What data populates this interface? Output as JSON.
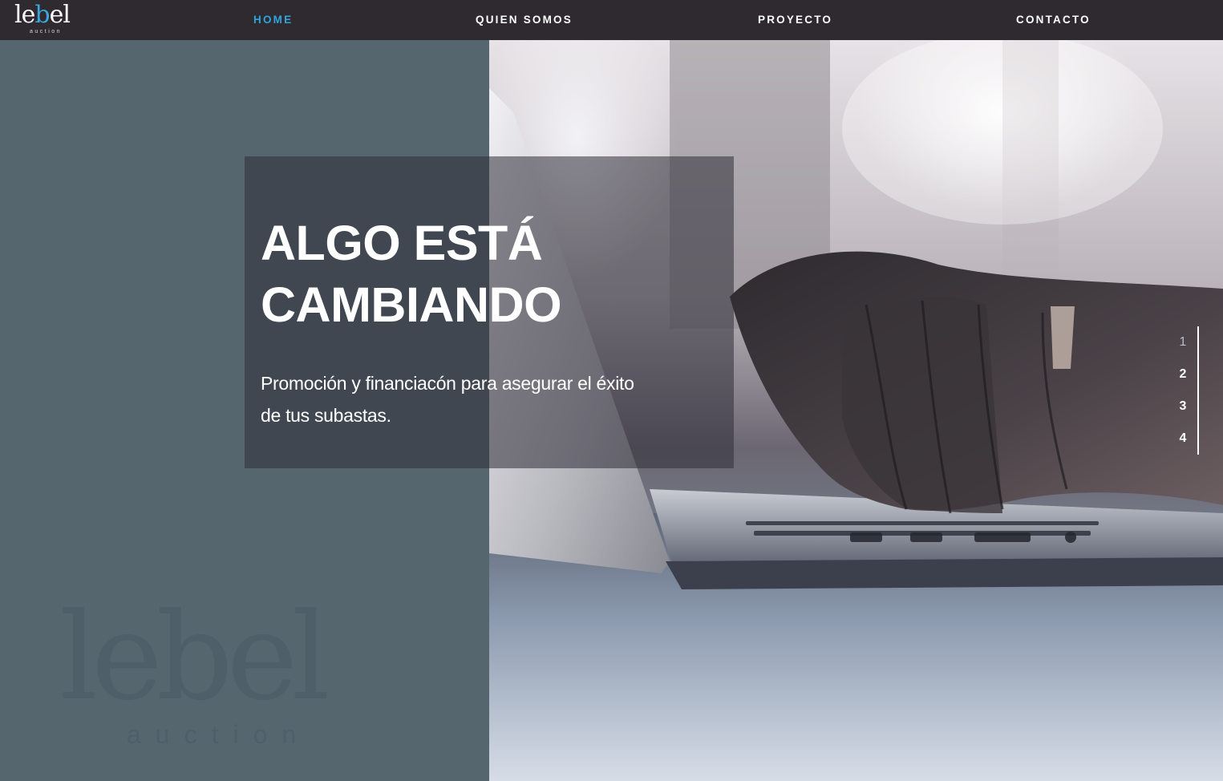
{
  "brand": {
    "logo_prefix": "le",
    "logo_accent": "b",
    "logo_suffix": "el",
    "logo_sub": "auction",
    "accent_color": "#3aa6db"
  },
  "nav": {
    "items": [
      {
        "label": "HOME",
        "active": true
      },
      {
        "label": "QUIEN SOMOS",
        "active": false
      },
      {
        "label": "PROYECTO",
        "active": false
      },
      {
        "label": "CONTACTO",
        "active": false
      }
    ]
  },
  "hero": {
    "headline_line1": "ALGO ESTÁ",
    "headline_line2": "CAMBIANDO",
    "subline_line1": "Promoción y financiacón para asegurar el éxito",
    "subline_line2": "de tus subastas.",
    "watermark_word": "lebel",
    "watermark_sub": "auction",
    "panel_color": "#55666f"
  },
  "slides": {
    "items": [
      "1",
      "2",
      "3",
      "4"
    ],
    "current": "1"
  }
}
